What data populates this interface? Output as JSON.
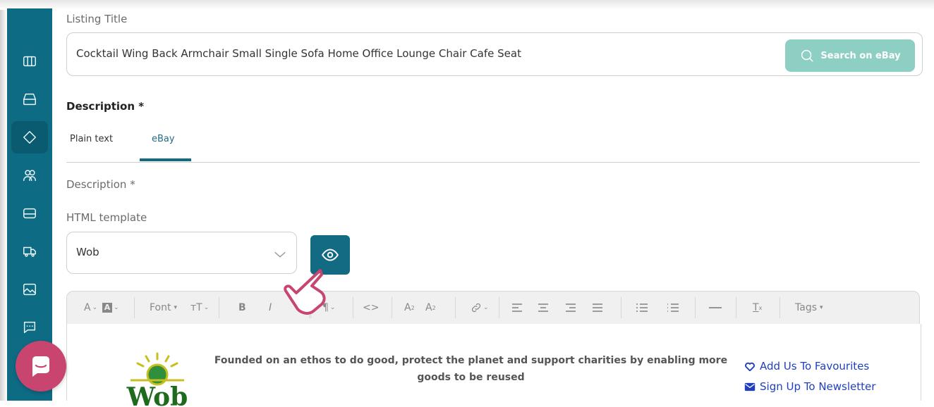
{
  "sidebar": {
    "items": [
      {
        "icon": "columns-icon",
        "active": false
      },
      {
        "icon": "inbox-icon",
        "active": false
      },
      {
        "icon": "tag-icon",
        "active": true
      },
      {
        "icon": "users-icon",
        "active": false
      },
      {
        "icon": "card-icon",
        "active": false
      },
      {
        "icon": "truck-icon",
        "active": false
      },
      {
        "icon": "image-icon",
        "active": false
      },
      {
        "icon": "message-icon",
        "active": false
      }
    ]
  },
  "listing": {
    "title_label": "Listing Title",
    "title_value": "Cocktail Wing Back Armchair Small Single Sofa Home Office Lounge Chair Cafe Seat",
    "search_label": "Search on eBay"
  },
  "description": {
    "heading": "Description *",
    "tabs": [
      {
        "label": "Plain text",
        "active": false
      },
      {
        "label": "eBay",
        "active": true
      }
    ],
    "sub_label": "Description *",
    "template_label": "HTML template",
    "template_value": "Wob"
  },
  "toolbar": {
    "font_label": "Font",
    "tags_label": "Tags",
    "paragraph_glyph": "¶",
    "code_glyph": "<>",
    "bold_glyph": "B",
    "italic_glyph": "I"
  },
  "editor": {
    "logo_text": "Wob",
    "ethos_text": "Founded on an ethos to do good, protect the planet and support charities by enabling more goods to be reused",
    "favourites_link": "Add Us To Favourites",
    "newsletter_link": "Sign Up To Newsletter"
  },
  "colors": {
    "sidebar": "#0d6b84",
    "accent": "#136a83",
    "search_button": "#8ecfc4",
    "chat_button": "#c7456f",
    "link": "#1f3fbf"
  }
}
